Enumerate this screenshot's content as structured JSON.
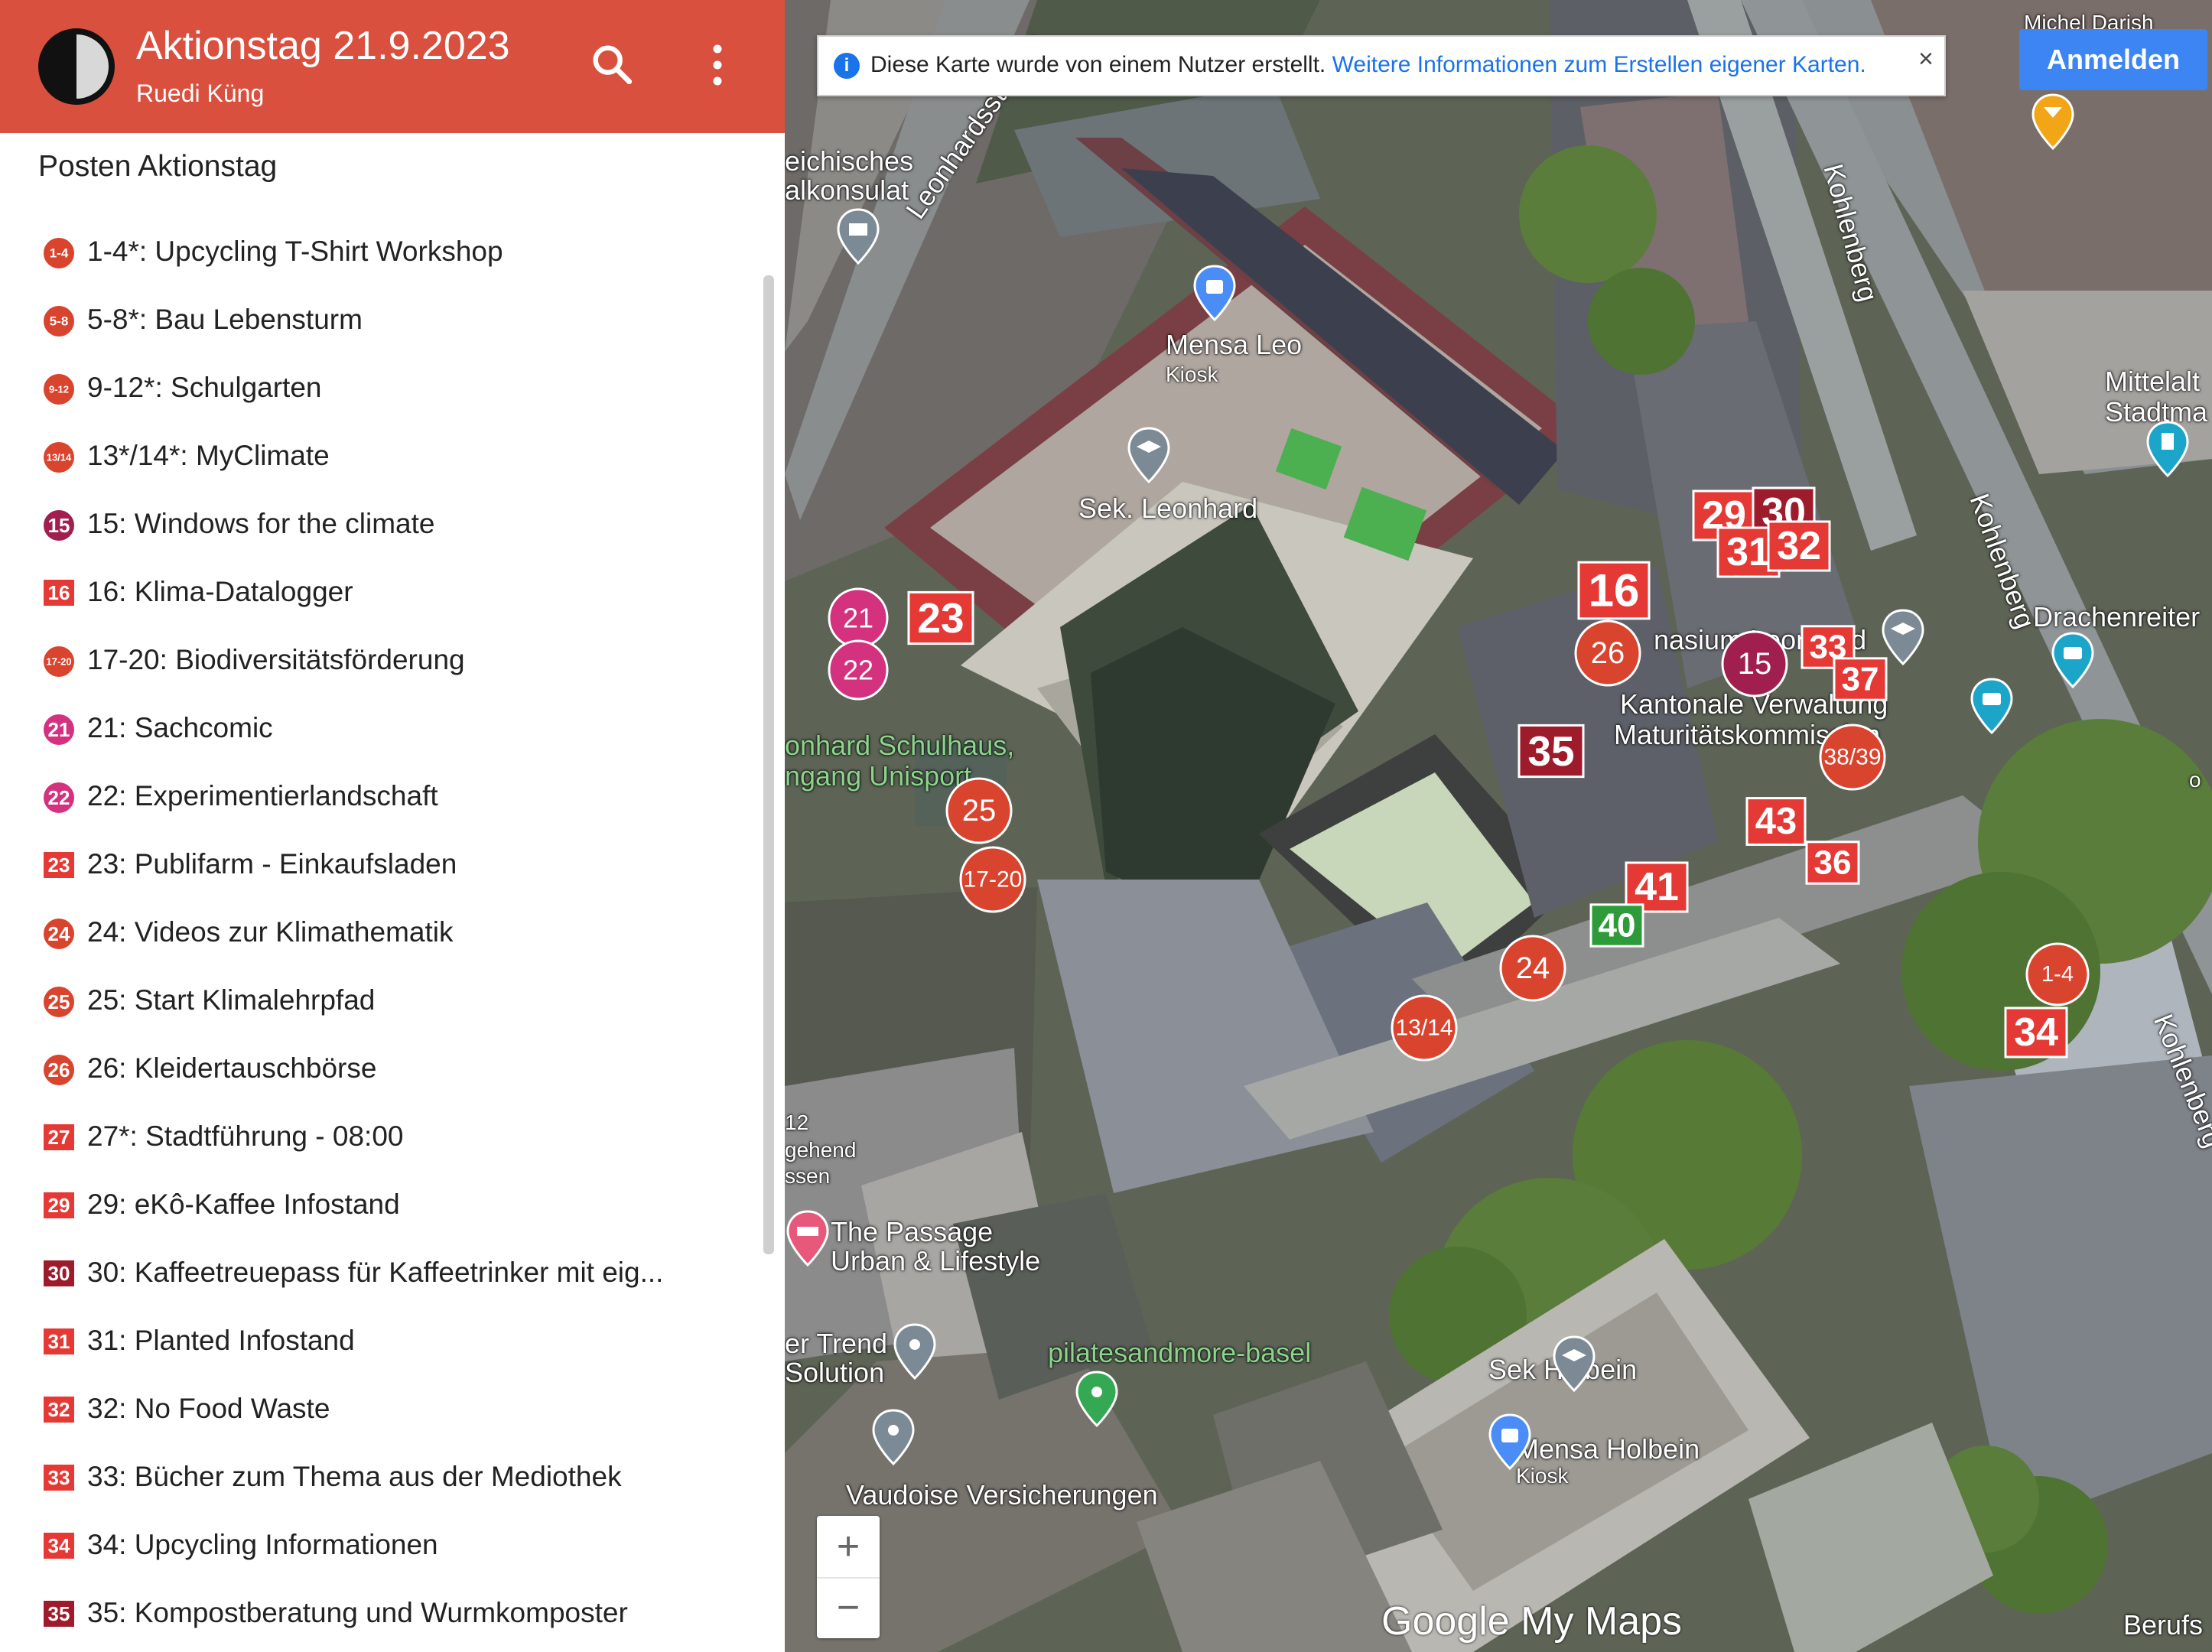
{
  "header": {
    "title": "Aktionstag 21.9.2023",
    "author": "Ruedi Küng",
    "search_icon": "search-icon",
    "menu_icon": "more-vert-icon"
  },
  "layer": {
    "title": "Posten Aktionstag"
  },
  "legend": [
    {
      "label": "1-4*: Upcycling T-Shirt Workshop",
      "icon_text": "1-4",
      "shape": "circle",
      "color": "#d9442e"
    },
    {
      "label": "5-8*: Bau Lebensturm",
      "icon_text": "5-8",
      "shape": "circle",
      "color": "#d9442e"
    },
    {
      "label": "9-12*: Schulgarten",
      "icon_text": "9-12",
      "shape": "circle",
      "color": "#d9442e"
    },
    {
      "label": "13*/14*: MyClimate",
      "icon_text": "13/14",
      "shape": "circle",
      "color": "#d9442e"
    },
    {
      "label": "15: Windows for the climate",
      "icon_text": "15",
      "shape": "circle",
      "color": "#a01f4f"
    },
    {
      "label": "16: Klima-Datalogger",
      "icon_text": "16",
      "shape": "square",
      "color": "#e53935"
    },
    {
      "label": "17-20: Biodiversitätsförderung",
      "icon_text": "17-20",
      "shape": "circle",
      "color": "#d9442e"
    },
    {
      "label": "21: Sachcomic",
      "icon_text": "21",
      "shape": "circle",
      "color": "#d4317f"
    },
    {
      "label": "22: Experimentierlandschaft",
      "icon_text": "22",
      "shape": "circle",
      "color": "#d4317f"
    },
    {
      "label": "23: Publifarm - Einkaufsladen",
      "icon_text": "23",
      "shape": "square",
      "color": "#e53935"
    },
    {
      "label": "24: Videos zur Klimathematik",
      "icon_text": "24",
      "shape": "circle",
      "color": "#d9442e"
    },
    {
      "label": "25: Start Klimalehrpfad",
      "icon_text": "25",
      "shape": "circle",
      "color": "#d9442e"
    },
    {
      "label": "26: Kleidertauschbörse",
      "icon_text": "26",
      "shape": "circle",
      "color": "#d9442e"
    },
    {
      "label": "27*: Stadtführung - 08:00",
      "icon_text": "27",
      "shape": "square",
      "color": "#e53935"
    },
    {
      "label": "29: eKô-Kaffee Infostand",
      "icon_text": "29",
      "shape": "square",
      "color": "#e53935"
    },
    {
      "label": "30: Kaffeetreuepass für Kaffeetrinker mit eig...",
      "icon_text": "30",
      "shape": "square",
      "color": "#9e1b2b"
    },
    {
      "label": "31: Planted Infostand",
      "icon_text": "31",
      "shape": "square",
      "color": "#e53935"
    },
    {
      "label": "32: No Food Waste",
      "icon_text": "32",
      "shape": "square",
      "color": "#e53935"
    },
    {
      "label": "33: Bücher zum Thema aus der Mediothek",
      "icon_text": "33",
      "shape": "square",
      "color": "#e53935"
    },
    {
      "label": "34: Upcycling Informationen",
      "icon_text": "34",
      "shape": "square",
      "color": "#e53935"
    },
    {
      "label": "35: Kompostberatung und Wurmkomposter",
      "icon_text": "35",
      "shape": "square",
      "color": "#9e1b2b"
    }
  ],
  "map": {
    "info_text": "Diese Karte wurde von einem Nutzer erstellt.",
    "info_link": "Weitere Informationen zum Erstellen eigener Karten.",
    "close": "×",
    "signin": "Anmelden",
    "zoom_in": "+",
    "zoom_out": "−",
    "attribution": "Google My Maps",
    "labels": {
      "leonhardsstrasse": "Leonhardsstrasse",
      "kohlenberg": "Kohlenberg",
      "mensa_leo": "Mensa Leo",
      "kiosk": "Kiosk",
      "sek_leonhard": "Sek. Leonhard",
      "mittelalt": "Mittelalt",
      "stadtma": "Stadtma",
      "drachenreiter": "Drachenreiter",
      "gymnasium": "nasium Leonhard",
      "kantonale": "Kantonale Verwaltung",
      "maturitat": "Maturitätskommission",
      "schulhaus": "onhard Schulhaus,",
      "unisport": "ngang Unisport",
      "konsulat1": "eichisches",
      "konsulat2": "alkonsulat",
      "passage1": "The Passage",
      "passage2": "Urban & Lifestyle",
      "trend1": "er Trend",
      "trend2": "Solution",
      "pilates": "pilatesandmore-basel",
      "sek_holbein": "Sek Holbein",
      "mensa_holbein": "Mensa Holbein",
      "kiosk2": "Kiosk",
      "vaudoise": "Vaudoise Versicherungen",
      "berufs": "Berufs",
      "ch12": "12",
      "gehend": "gehend",
      "essen": "ssen",
      "michel": "Michel Darish",
      "ox": "o"
    },
    "markers": [
      {
        "text": "21",
        "shape": "circle",
        "color": "#d4317f"
      },
      {
        "text": "22",
        "shape": "circle",
        "color": "#d4317f"
      },
      {
        "text": "23",
        "shape": "square",
        "color": "#e53935"
      },
      {
        "text": "25",
        "shape": "circle",
        "color": "#d9442e"
      },
      {
        "text": "17-20",
        "shape": "circle",
        "color": "#d9442e"
      },
      {
        "text": "16",
        "shape": "square",
        "color": "#e53935"
      },
      {
        "text": "26",
        "shape": "circle",
        "color": "#d9442e"
      },
      {
        "text": "29",
        "shape": "square",
        "color": "#e53935"
      },
      {
        "text": "30",
        "shape": "square",
        "color": "#9e1b2b"
      },
      {
        "text": "31",
        "shape": "square",
        "color": "#e53935"
      },
      {
        "text": "32",
        "shape": "square",
        "color": "#e53935"
      },
      {
        "text": "15",
        "shape": "circle",
        "color": "#a01f4f"
      },
      {
        "text": "33",
        "shape": "square",
        "color": "#e53935"
      },
      {
        "text": "37",
        "shape": "square",
        "color": "#e53935"
      },
      {
        "text": "35",
        "shape": "square",
        "color": "#9e1b2b"
      },
      {
        "text": "38/39",
        "shape": "circle",
        "color": "#d9442e"
      },
      {
        "text": "43",
        "shape": "square",
        "color": "#e53935"
      },
      {
        "text": "36",
        "shape": "square",
        "color": "#e53935"
      },
      {
        "text": "41",
        "shape": "square",
        "color": "#e53935"
      },
      {
        "text": "40",
        "shape": "square",
        "color": "#2e9b3a"
      },
      {
        "text": "24",
        "shape": "circle",
        "color": "#d9442e"
      },
      {
        "text": "13/14",
        "shape": "circle",
        "color": "#d9442e"
      },
      {
        "text": "1-4",
        "shape": "circle",
        "color": "#d9442e"
      },
      {
        "text": "34",
        "shape": "square",
        "color": "#e53935"
      }
    ]
  }
}
